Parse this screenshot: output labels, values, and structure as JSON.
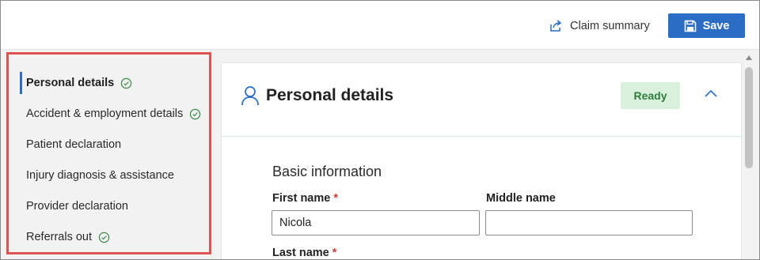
{
  "header": {
    "claim_summary_label": "Claim summary",
    "save_label": "Save"
  },
  "sidebar": {
    "items": [
      {
        "label": "Personal details",
        "completed": true,
        "active": true
      },
      {
        "label": "Accident & employment details",
        "completed": true,
        "active": false
      },
      {
        "label": "Patient declaration",
        "completed": false,
        "active": false
      },
      {
        "label": "Injury diagnosis & assistance",
        "completed": false,
        "active": false
      },
      {
        "label": "Provider declaration",
        "completed": false,
        "active": false
      },
      {
        "label": "Referrals out",
        "completed": true,
        "active": false
      }
    ]
  },
  "main": {
    "title": "Personal details",
    "status_badge": "Ready",
    "section_title": "Basic information",
    "fields": {
      "first_name": {
        "label": "First name",
        "required_mark": "*",
        "value": "Nicola"
      },
      "middle_name": {
        "label": "Middle name",
        "value": ""
      },
      "last_name": {
        "label": "Last name",
        "required_mark": "*"
      }
    }
  },
  "colors": {
    "accent": "#2b6cc4",
    "highlight_border": "#e05252",
    "ready_bg": "#d8f0dc",
    "ready_text": "#2e7d3a",
    "check_green": "#3a8a4a"
  }
}
